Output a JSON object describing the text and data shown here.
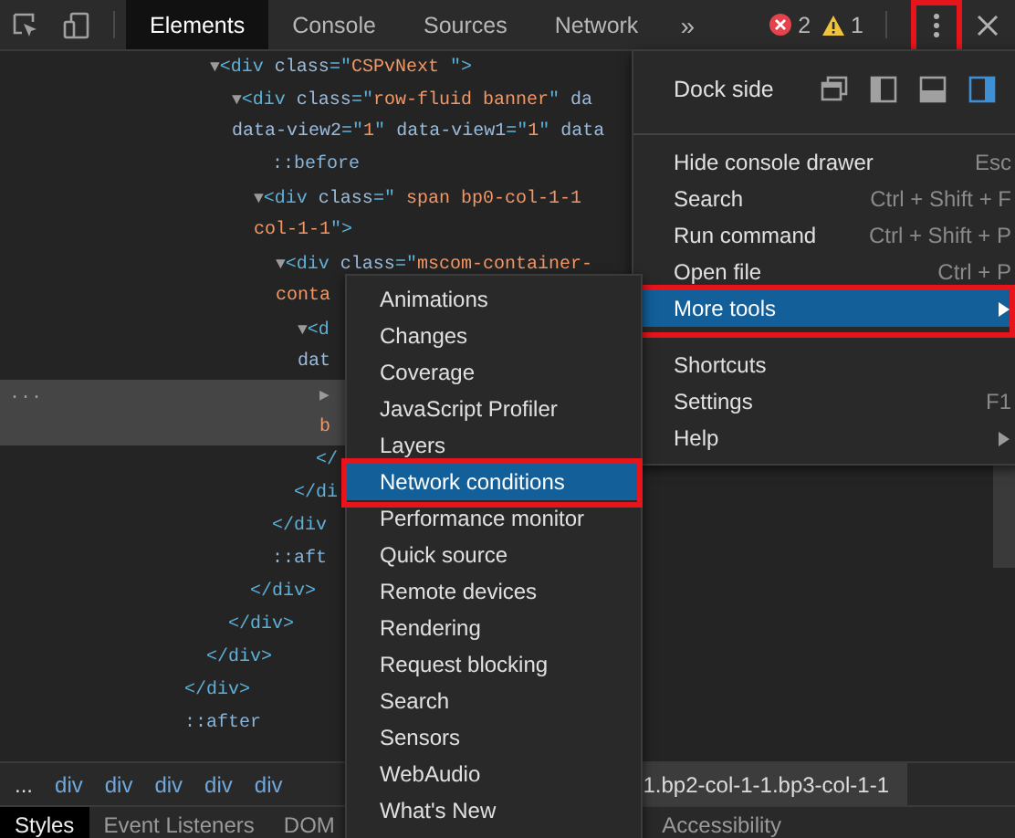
{
  "toolbar": {
    "tabs": [
      {
        "label": "Elements",
        "selected": true
      },
      {
        "label": "Console",
        "selected": false
      },
      {
        "label": "Sources",
        "selected": false
      },
      {
        "label": "Network",
        "selected": false
      }
    ],
    "overflow": "»",
    "errors": "2",
    "warnings": "1",
    "menu_button": {
      "highlighted": true
    }
  },
  "dom_tree": [
    {
      "selected": false,
      "close": [
        {
          "kind": "tag",
          "text": "</div>"
        }
      ],
      "children": [
        {
          "selected": false,
          "close": [
            {
              "kind": "tag",
              "text": "</div>"
            }
          ],
          "children": [
            {
              "lines": [
                [
                  {
                    "kind": "toggle",
                    "text": "▼"
                  },
                  {
                    "kind": "tag",
                    "text": "<div "
                  },
                  {
                    "kind": "attr",
                    "text": "class"
                  },
                  {
                    "kind": "tag",
                    "text": "=\""
                  },
                  {
                    "kind": "value",
                    "text": "CSPvNext "
                  },
                  {
                    "kind": "tag",
                    "text": "\">"
                  }
                ]
              ],
              "selected": false,
              "close": [
                {
                  "kind": "tag",
                  "text": "</div>"
                }
              ],
              "children": [
                {
                  "lines": [
                    [
                      {
                        "kind": "toggle",
                        "text": "▼"
                      },
                      {
                        "kind": "tag",
                        "text": "<div "
                      },
                      {
                        "kind": "attr",
                        "text": "class"
                      },
                      {
                        "kind": "tag",
                        "text": "=\""
                      },
                      {
                        "kind": "value",
                        "text": "row-fluid banner"
                      },
                      {
                        "kind": "tag",
                        "text": "\" "
                      },
                      {
                        "kind": "attr",
                        "text": "da"
                      }
                    ],
                    [
                      {
                        "kind": "attr",
                        "text": "data-view2"
                      },
                      {
                        "kind": "tag",
                        "text": "=\""
                      },
                      {
                        "kind": "value",
                        "text": "1"
                      },
                      {
                        "kind": "tag",
                        "text": "\" "
                      },
                      {
                        "kind": "attr",
                        "text": "data-view1"
                      },
                      {
                        "kind": "tag",
                        "text": "=\""
                      },
                      {
                        "kind": "value",
                        "text": "1"
                      },
                      {
                        "kind": "tag",
                        "text": "\" "
                      },
                      {
                        "kind": "attr",
                        "text": "data"
                      }
                    ]
                  ],
                  "selected": false,
                  "close": [
                    {
                      "kind": "tag",
                      "text": "</div>"
                    }
                  ],
                  "children": [
                    {
                      "lines": [
                        [
                          {
                            "kind": "pseudo",
                            "text": "::before"
                          }
                        ]
                      ],
                      "selected": false
                    },
                    {
                      "lines": [
                        [
                          {
                            "kind": "toggle",
                            "text": "▼"
                          },
                          {
                            "kind": "tag",
                            "text": "<div "
                          },
                          {
                            "kind": "attr",
                            "text": "class"
                          },
                          {
                            "kind": "tag",
                            "text": "=\""
                          },
                          {
                            "kind": "value",
                            "text": " span bp0-col-1-1"
                          }
                        ],
                        [
                          {
                            "kind": "value",
                            "text": "col-1-1"
                          },
                          {
                            "kind": "tag",
                            "text": "\">"
                          }
                        ]
                      ],
                      "selected": false,
                      "close": [
                        {
                          "kind": "tag",
                          "text": "</div"
                        }
                      ],
                      "children": [
                        {
                          "lines": [
                            [
                              {
                                "kind": "toggle",
                                "text": "▼"
                              },
                              {
                                "kind": "tag",
                                "text": "<div "
                              },
                              {
                                "kind": "attr",
                                "text": "class"
                              },
                              {
                                "kind": "tag",
                                "text": "=\""
                              },
                              {
                                "kind": "value",
                                "text": "mscom-container-"
                              }
                            ],
                            [
                              {
                                "kind": "value",
                                "text": "conta"
                              }
                            ]
                          ],
                          "selected": false,
                          "close": [
                            {
                              "kind": "tag",
                              "text": "</di"
                            }
                          ],
                          "children": [
                            {
                              "lines": [
                                [
                                  {
                                    "kind": "toggle",
                                    "text": "▼"
                                  },
                                  {
                                    "kind": "tag",
                                    "text": "<d"
                                  }
                                ],
                                [
                                  {
                                    "kind": "attr",
                                    "text": "dat"
                                  }
                                ]
                              ],
                              "selected": false,
                              "close": [
                                {
                                  "kind": "tag",
                                  "text": "</"
                                }
                              ],
                              "children": [
                                {
                                  "lines": [
                                    [
                                      {
                                        "kind": "toggle",
                                        "text": "▶"
                                      }
                                    ],
                                    [
                                      {
                                        "kind": "value",
                                        "text": "b"
                                      }
                                    ]
                                  ],
                                  "selected": true,
                                  "marker": "..."
                                }
                              ]
                            }
                          ]
                        }
                      ]
                    },
                    {
                      "lines": [
                        [
                          {
                            "kind": "pseudo",
                            "text": "::aft"
                          }
                        ]
                      ],
                      "selected": false
                    }
                  ]
                }
              ]
            }
          ]
        }
      ]
    },
    {
      "lines": [
        [
          {
            "kind": "pseudo",
            "text": "::after"
          }
        ]
      ],
      "selected": false
    }
  ],
  "breadcrumbs": [
    {
      "label": "...",
      "selected": false
    },
    {
      "label": "div",
      "selected": false
    },
    {
      "label": "div",
      "selected": false
    },
    {
      "label": "div",
      "selected": false
    },
    {
      "label": "div",
      "selected": false
    },
    {
      "label": "div",
      "selected": false
    },
    {
      "label": "1.bp2-col-1-1.bp3-col-1-1",
      "selected": true
    }
  ],
  "bottom_tabs": [
    {
      "label": "Styles",
      "selected": true
    },
    {
      "label": "Event Listeners",
      "selected": false
    },
    {
      "label": "DOM",
      "selected": false
    },
    {
      "label": "Accessibility",
      "selected": false
    }
  ],
  "main_menu": {
    "dock_side": {
      "label": "Dock side",
      "options": [
        {
          "kind": "undock",
          "selected": false
        },
        {
          "kind": "left",
          "selected": false
        },
        {
          "kind": "bottom",
          "selected": false
        },
        {
          "kind": "right",
          "selected": true
        }
      ]
    },
    "items": [
      {
        "kind": "separator"
      },
      {
        "kind": "item",
        "label": "Hide console drawer",
        "shortcut": "Esc",
        "selected": false,
        "highlighted": false,
        "submenu": false
      },
      {
        "kind": "item",
        "label": "Search",
        "shortcut": "Ctrl + Shift + F",
        "selected": false,
        "highlighted": false,
        "submenu": false
      },
      {
        "kind": "item",
        "label": "Run command",
        "shortcut": "Ctrl + Shift + P",
        "selected": false,
        "highlighted": false,
        "submenu": false
      },
      {
        "kind": "item",
        "label": "Open file",
        "shortcut": "Ctrl + P",
        "selected": false,
        "highlighted": false,
        "submenu": false
      },
      {
        "kind": "item",
        "label": "More tools",
        "selected": true,
        "highlighted": true,
        "submenu": true
      },
      {
        "kind": "separator"
      },
      {
        "kind": "item",
        "label": "Shortcuts",
        "selected": false,
        "highlighted": false,
        "submenu": false
      },
      {
        "kind": "item",
        "label": "Settings",
        "shortcut": "F1",
        "selected": false,
        "highlighted": false,
        "submenu": false
      },
      {
        "kind": "item",
        "label": "Help",
        "selected": false,
        "highlighted": false,
        "submenu": true
      }
    ]
  },
  "submenu": [
    {
      "label": "Animations",
      "selected": false,
      "highlighted": false
    },
    {
      "label": "Changes",
      "selected": false,
      "highlighted": false
    },
    {
      "label": "Coverage",
      "selected": false,
      "highlighted": false
    },
    {
      "label": "JavaScript Profiler",
      "selected": false,
      "highlighted": false
    },
    {
      "label": "Layers",
      "selected": false,
      "highlighted": false
    },
    {
      "label": "Network conditions",
      "selected": true,
      "highlighted": true
    },
    {
      "label": "Performance monitor",
      "selected": false,
      "highlighted": false
    },
    {
      "label": "Quick source",
      "selected": false,
      "highlighted": false
    },
    {
      "label": "Remote devices",
      "selected": false,
      "highlighted": false
    },
    {
      "label": "Rendering",
      "selected": false,
      "highlighted": false
    },
    {
      "label": "Request blocking",
      "selected": false,
      "highlighted": false
    },
    {
      "label": "Search",
      "selected": false,
      "highlighted": false
    },
    {
      "label": "Sensors",
      "selected": false,
      "highlighted": false
    },
    {
      "label": "WebAudio",
      "selected": false,
      "highlighted": false
    },
    {
      "label": "What's New",
      "selected": false,
      "highlighted": false
    }
  ]
}
